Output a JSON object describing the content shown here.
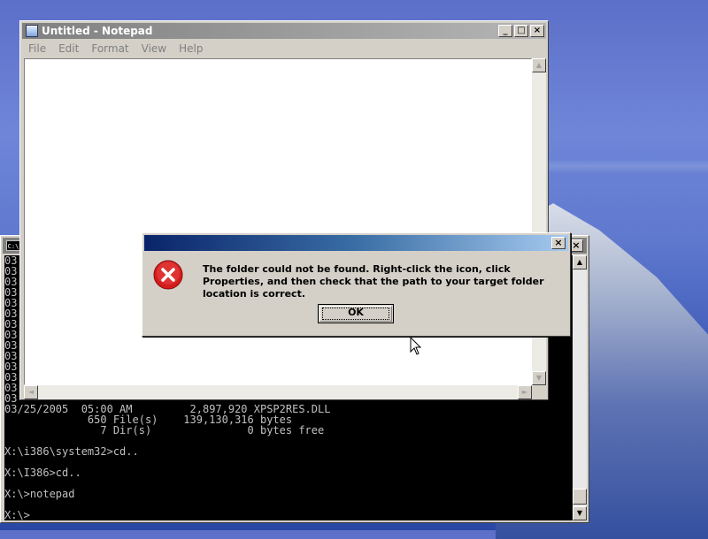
{
  "console": {
    "icon_text": "C:\\",
    "close_label": "×",
    "lines": [
      "03",
      "03",
      "03",
      "03",
      "03",
      "03",
      "03",
      "03",
      "03",
      "03",
      "03",
      "03",
      "03",
      "03",
      "03/25/2005  05:00 AM         2,897,920 XPSP2RES.DLL",
      "             650 File(s)    139,130,316 bytes",
      "               7 Dir(s)               0 bytes free",
      "",
      "X:\\i386\\system32>cd..",
      "",
      "X:\\I386>cd..",
      "",
      "X:\\>notepad",
      "",
      "X:\\>"
    ],
    "scroll_up": "▲",
    "scroll_down": "▼"
  },
  "notepad": {
    "title": "Untitled - Notepad",
    "minimize_label": "_",
    "maximize_label": "□",
    "close_label": "×",
    "menu": [
      "File",
      "Edit",
      "Format",
      "View",
      "Help"
    ],
    "scroll_up": "▲",
    "scroll_down": "▼",
    "scroll_left": "◄",
    "scroll_right": "►"
  },
  "dialog": {
    "title": "",
    "close_label": "×",
    "icon": "error-icon",
    "message": "The  folder could not be found. Right-click the  icon, click Properties, and then check that the path to your target folder location is correct.",
    "ok_label": "OK"
  },
  "colors": {
    "desktop": "#5c6fc9",
    "dialog_title_start": "#0a246a",
    "dialog_title_end": "#a6caf0",
    "error_red": "#d41c1c"
  }
}
